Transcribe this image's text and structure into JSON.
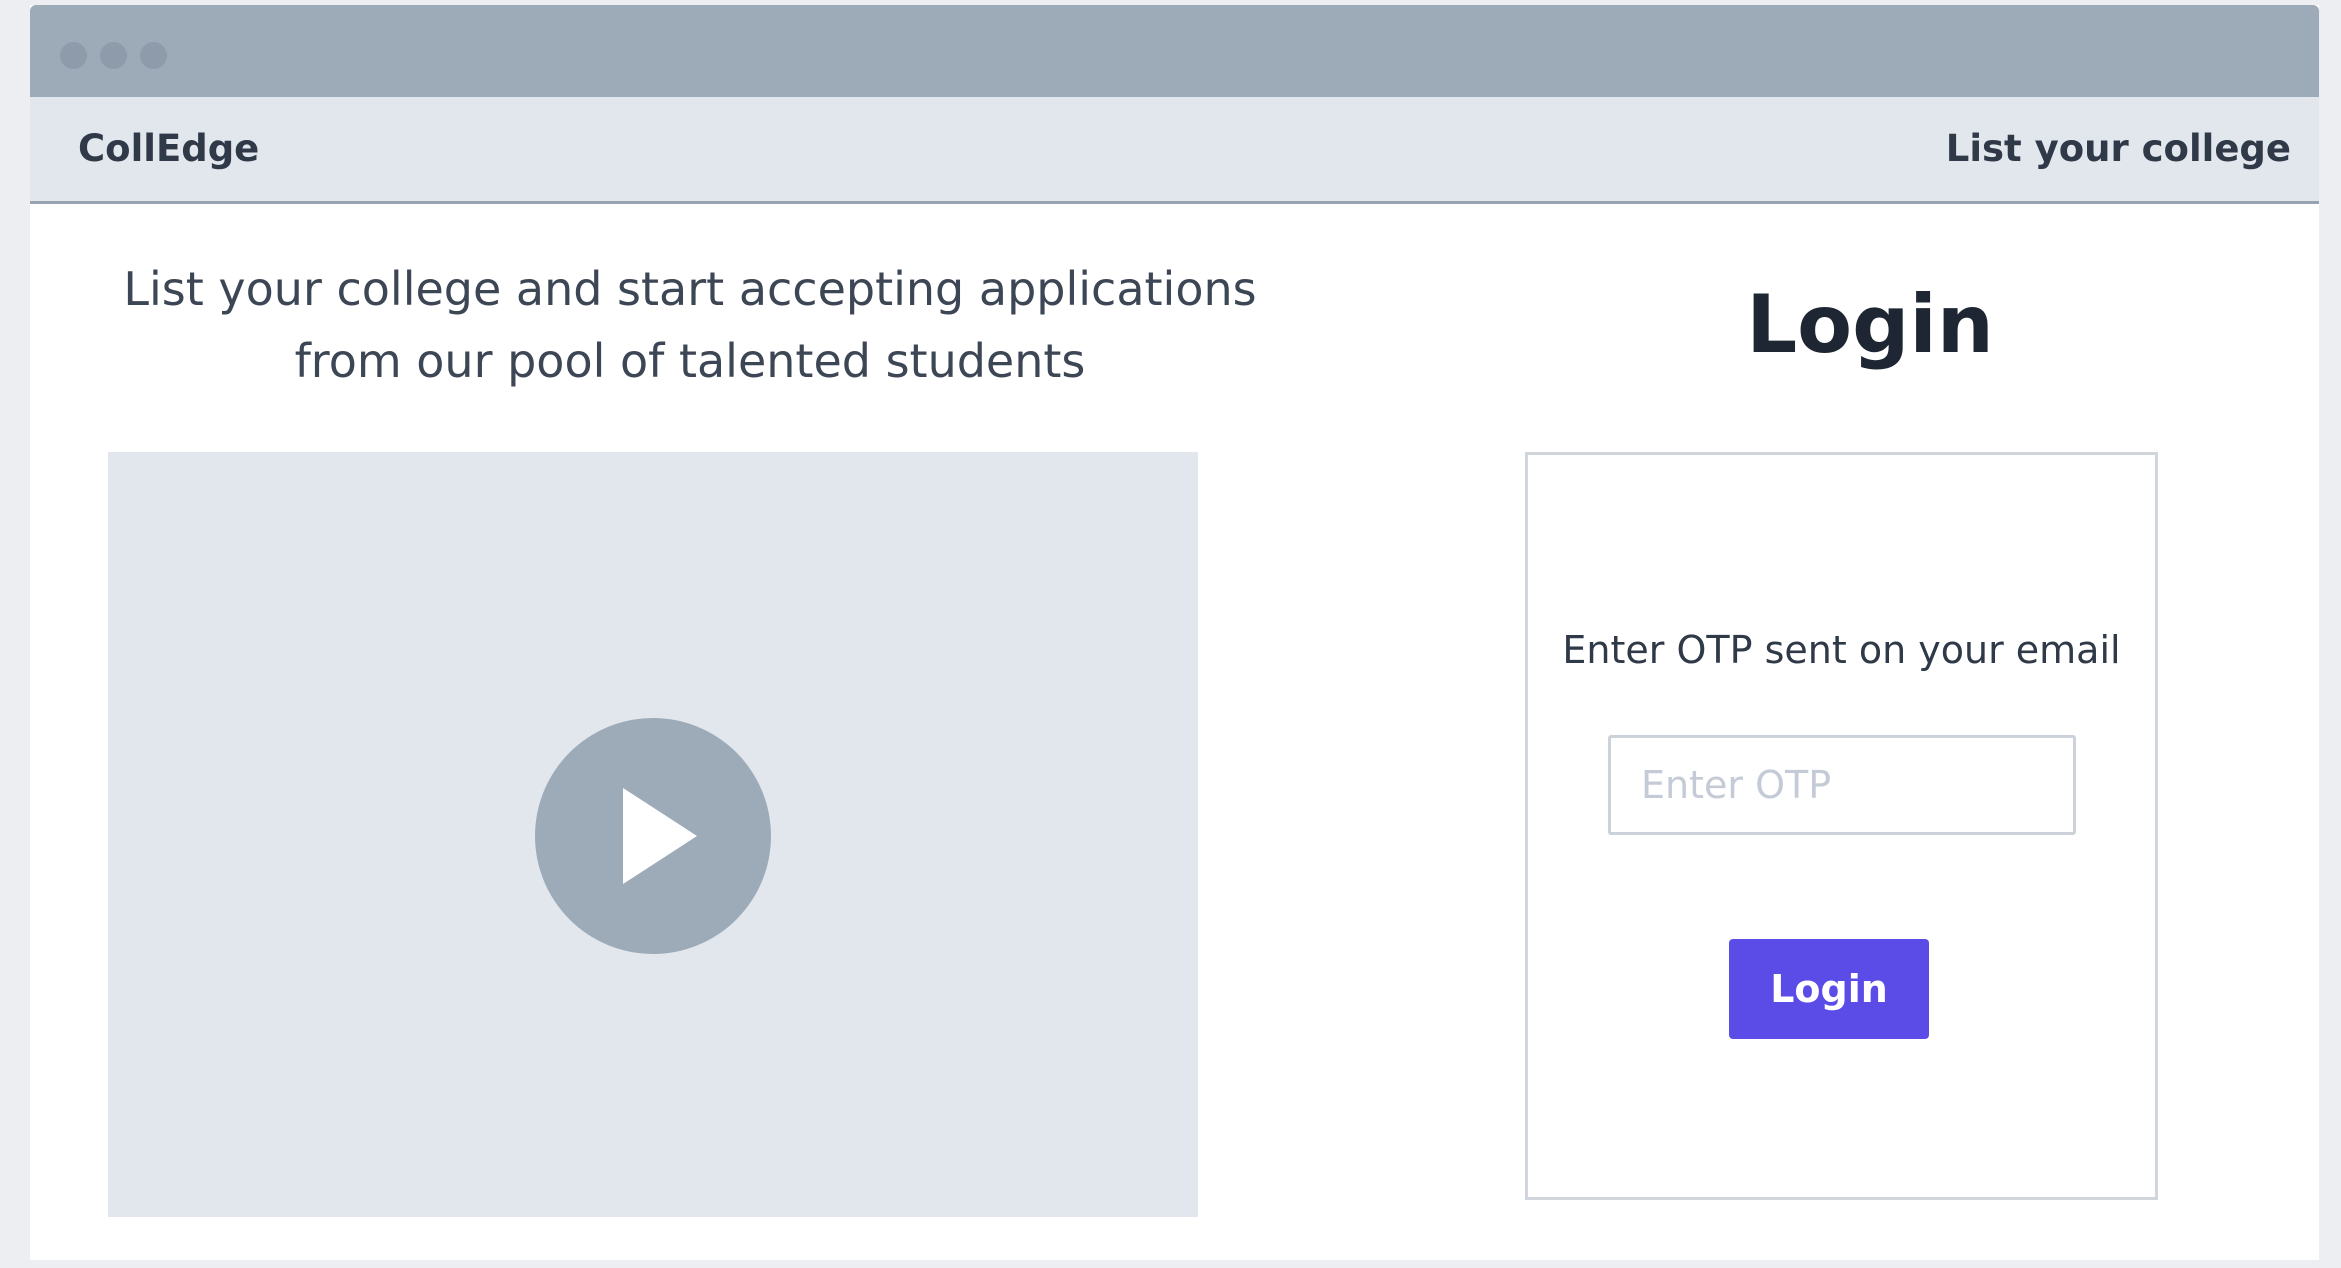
{
  "navbar": {
    "brand": "CollEdge",
    "link_label": "List your college"
  },
  "hero": {
    "tagline_line1": "List your college and start accepting applications",
    "tagline_line2": "from our pool of talented students"
  },
  "video": {
    "icon": "play-icon"
  },
  "login": {
    "heading": "Login",
    "otp_label": "Enter OTP sent on your email",
    "otp_placeholder": "Enter OTP",
    "otp_value": "",
    "button_label": "Login"
  },
  "colors": {
    "titlebar": "#9daab8",
    "navbar_bg": "#e2e7ed",
    "video_bg": "#e2e7ed",
    "play_button": "#9daab8",
    "accent": "#5b4ce8",
    "text": "#2f3947"
  }
}
